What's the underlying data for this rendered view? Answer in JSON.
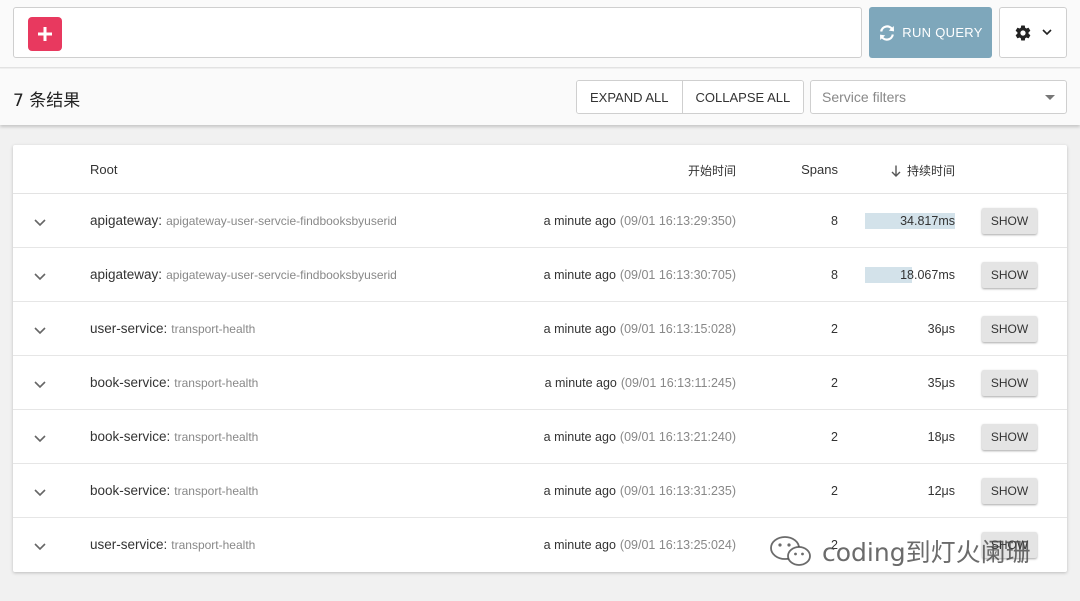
{
  "toolbar": {
    "add_icon": "plus-icon",
    "run_query_label": "RUN QUERY",
    "run_icon": "refresh-icon",
    "settings_icon": "gear-icon",
    "settings_caret_icon": "chevron-down-icon"
  },
  "results": {
    "count_label": "7 条结果",
    "expand_all_label": "EXPAND ALL",
    "collapse_all_label": "COLLAPSE ALL",
    "service_filter_placeholder": "Service filters"
  },
  "table": {
    "headers": {
      "root": "Root",
      "start_time": "开始时间",
      "spans": "Spans",
      "duration": "持续时间"
    },
    "show_label": "SHOW",
    "rows": [
      {
        "service": "apigateway:",
        "span": "apigateway-user-servcie-findbooksbyuserid",
        "relative": "a minute ago",
        "absolute": "(09/01 16:13:29:350)",
        "spans": "8",
        "duration": "34.817ms",
        "duration_fraction": 1.0
      },
      {
        "service": "apigateway:",
        "span": "apigateway-user-servcie-findbooksbyuserid",
        "relative": "a minute ago",
        "absolute": "(09/01 16:13:30:705)",
        "spans": "8",
        "duration": "18.067ms",
        "duration_fraction": 0.52
      },
      {
        "service": "user-service:",
        "span": "transport-health",
        "relative": "a minute ago",
        "absolute": "(09/01 16:13:15:028)",
        "spans": "2",
        "duration": "36μs",
        "duration_fraction": 0
      },
      {
        "service": "book-service:",
        "span": "transport-health",
        "relative": "a minute ago",
        "absolute": "(09/01 16:13:11:245)",
        "spans": "2",
        "duration": "35μs",
        "duration_fraction": 0
      },
      {
        "service": "book-service:",
        "span": "transport-health",
        "relative": "a minute ago",
        "absolute": "(09/01 16:13:21:240)",
        "spans": "2",
        "duration": "18μs",
        "duration_fraction": 0
      },
      {
        "service": "book-service:",
        "span": "transport-health",
        "relative": "a minute ago",
        "absolute": "(09/01 16:13:31:235)",
        "spans": "2",
        "duration": "12μs",
        "duration_fraction": 0
      },
      {
        "service": "user-service:",
        "span": "transport-health",
        "relative": "a minute ago",
        "absolute": "(09/01 16:13:25:024)",
        "spans": "2",
        "duration": "",
        "duration_fraction": 0
      }
    ]
  },
  "watermark": {
    "text": "coding到灯火阑珊",
    "icon": "wechat-icon"
  },
  "colors": {
    "add_button": "#e8395f",
    "run_button": "#7ea7bb",
    "duration_bar": "#d3e2ea"
  }
}
